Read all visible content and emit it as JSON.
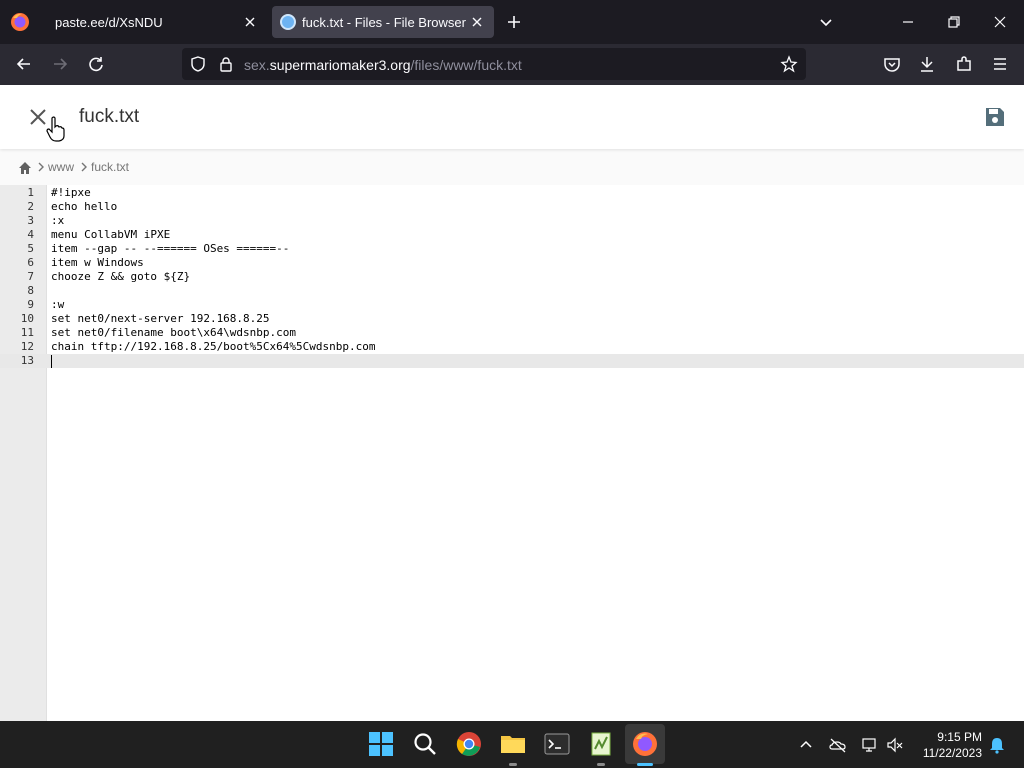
{
  "browser": {
    "tabs": [
      {
        "label": "paste.ee/d/XsNDU",
        "active": false
      },
      {
        "label": "fuck.txt - Files - File Browser",
        "active": true
      }
    ],
    "url": {
      "prefix": "sex.",
      "domain": "supermariomaker3.org",
      "path": "/files/www/fuck.txt"
    }
  },
  "app": {
    "title": "fuck.txt",
    "breadcrumbs": [
      "www",
      "fuck.txt"
    ]
  },
  "editor": {
    "lines": [
      {
        "num": "1",
        "code": "#!ipxe"
      },
      {
        "num": "2",
        "code": "echo hello"
      },
      {
        "num": "3",
        "code": ":x"
      },
      {
        "num": "4",
        "code": "menu CollabVM iPXE"
      },
      {
        "num": "5",
        "code": "item --gap -- --====== OSes ======--"
      },
      {
        "num": "6",
        "code": "item w Windows"
      },
      {
        "num": "7",
        "code": "chooze Z && goto ${Z}"
      },
      {
        "num": "8",
        "code": ""
      },
      {
        "num": "9",
        "code": ":w"
      },
      {
        "num": "10",
        "code": "set net0/next-server 192.168.8.25"
      },
      {
        "num": "11",
        "code": "set net0/filename boot\\x64\\wdsnbp.com"
      },
      {
        "num": "12",
        "code": "chain tftp://192.168.8.25/boot%5Cx64%5Cwdsnbp.com"
      },
      {
        "num": "13",
        "code": ""
      }
    ],
    "active_line": "13"
  },
  "taskbar": {
    "time": "9:15 PM",
    "date": "11/22/2023"
  },
  "colors": {
    "accent": "#4cc2ff",
    "browser_bg": "#1c1b22",
    "toolbar_bg": "#2b2a33",
    "editor_gutter": "#ebebeb"
  }
}
